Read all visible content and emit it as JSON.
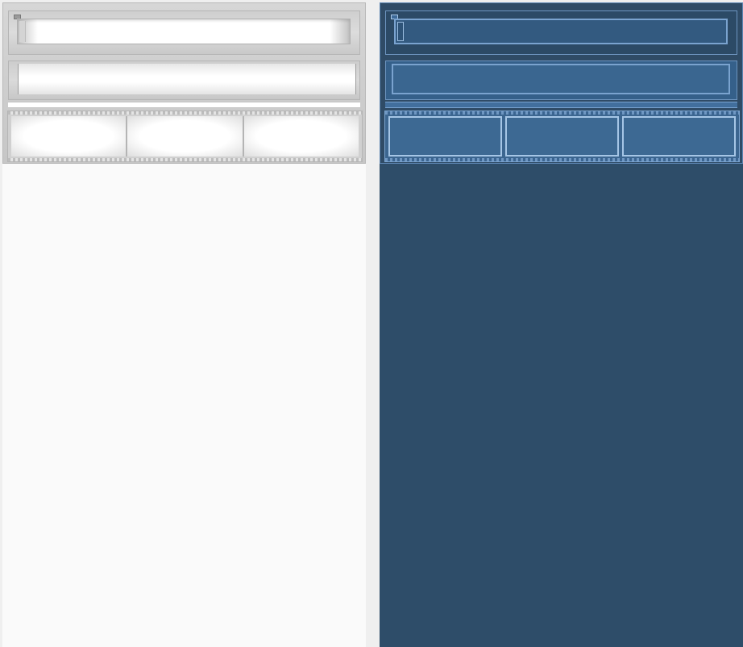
{
  "panels": [
    {
      "theme": "light",
      "colors": {
        "background": "#fafafa",
        "chrome": "#d0d0d0",
        "field": "#ffffff"
      },
      "rows": [
        "header-field",
        "text-field",
        "separator",
        "cell-group"
      ],
      "cell_group_count": 3
    },
    {
      "theme": "dark",
      "colors": {
        "background": "#2e4d69",
        "chrome": "#3c6690",
        "border": "#7aa3cf"
      },
      "rows": [
        "header-field",
        "text-field",
        "separator",
        "cell-group"
      ],
      "cell_group_count": 3
    }
  ]
}
